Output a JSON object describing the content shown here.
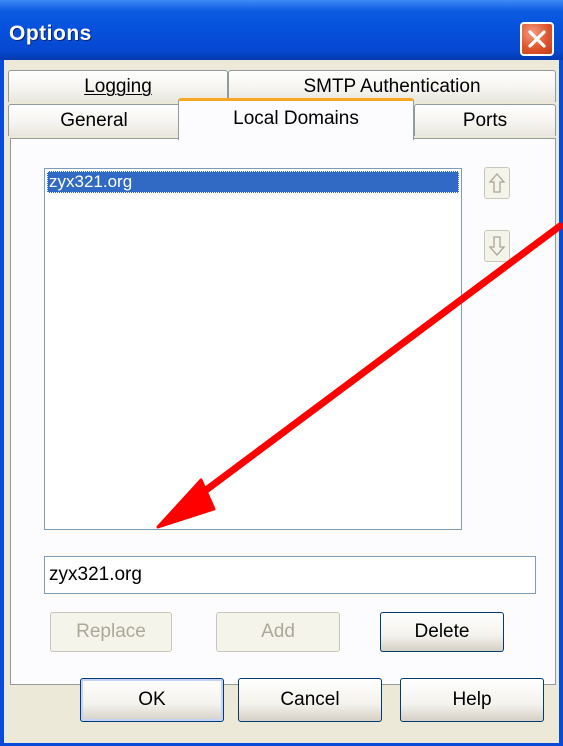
{
  "window": {
    "title": "Options"
  },
  "tabs": {
    "row_back": [
      {
        "label": "Logging",
        "mnemonic": "L"
      },
      {
        "label": "SMTP Authentication",
        "mnemonic": "S"
      }
    ],
    "row_front": [
      {
        "label": "General",
        "mnemonic": "G"
      },
      {
        "label": "Local Domains",
        "mnemonic": "L",
        "active": true
      },
      {
        "label": "Ports",
        "mnemonic": "P"
      }
    ]
  },
  "domains_list": {
    "items": [
      "zyx321.org"
    ],
    "selected_index": 0
  },
  "domain_input": {
    "value": "zyx321.org"
  },
  "actions": {
    "replace_label": "Replace",
    "add_label": "Add",
    "delete_label": "Delete"
  },
  "footer": {
    "ok_label": "OK",
    "cancel_label": "Cancel",
    "help_label": "Help"
  },
  "colors": {
    "title_bar": "#0550dc",
    "close_button": "#e0542c",
    "selection": "#316ac5",
    "active_tab_accent": "#f5a623",
    "annotation_arrow": "#ff0000"
  },
  "icons": {
    "close": "close-x-icon",
    "move_up": "arrow-up-icon",
    "move_down": "arrow-down-icon"
  }
}
